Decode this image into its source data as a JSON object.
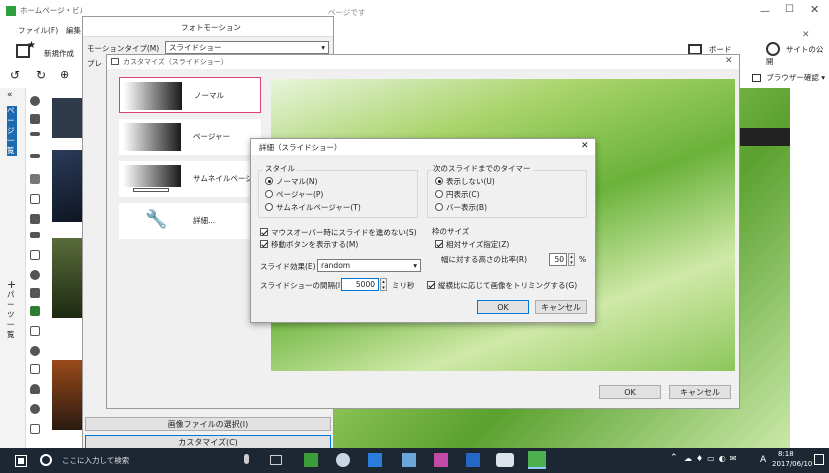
{
  "app": {
    "title": "ホームページ・ビルダー",
    "doc_title": "ページです",
    "menu_file": "ファイル(F)",
    "menu_edit": "編集",
    "new_label": "新規作成",
    "right_buttons": [
      "ボード",
      "サイトの公開"
    ],
    "browser_check": "ブラウザー確認",
    "left_vertical_labels": [
      "ページ一覧",
      "パーツ一覧"
    ]
  },
  "photo_motion": {
    "title": "フォトモーション",
    "motion_type_label": "モーションタイプ(M)",
    "motion_type_value": "スライドショー",
    "preview_label": "プレ",
    "select_image_button": "画像ファイルの選択(I)",
    "customize_button": "カスタマイズ(C)"
  },
  "customize": {
    "title": "カスタマイズ（スライドショー）",
    "items": [
      {
        "label": "ノーマル"
      },
      {
        "label": "ページャー"
      },
      {
        "label": "サムネイルページャー"
      },
      {
        "label": "詳細..."
      }
    ],
    "ok": "OK",
    "cancel": "キャンセル"
  },
  "detail": {
    "title": "詳細（スライドショー）",
    "style_group": "スタイル",
    "style_options": [
      "ノーマル(N)",
      "ページャー(P)",
      "サムネイルページャー(T)"
    ],
    "style_selected": 0,
    "timer_group": "次のスライドまでのタイマー",
    "timer_options": [
      "表示しない(U)",
      "円表示(C)",
      "バー表示(B)"
    ],
    "timer_selected": 0,
    "check_hover": "マウスオーバー時にスライドを進めない(S)",
    "check_hover_checked": true,
    "check_nav": "移動ボタンを表示する(M)",
    "check_nav_checked": true,
    "effect_label": "スライド効果(E)",
    "effect_value": "random",
    "interval_label": "スライドショーの間隔(I)",
    "interval_value": "5000",
    "interval_unit": "ミリ秒",
    "frame_group": "枠のサイズ",
    "relative_size_label": "相対サイズ指定(Z)",
    "relative_size_checked": true,
    "width_ratio_label": "幅に対する高さの比率(R)",
    "width_ratio_value": "50",
    "width_ratio_unit": "%",
    "trim_label": "縦横比に応じて画像をトリミングする(G)",
    "trim_checked": true,
    "ok": "OK",
    "cancel": "キャンセル"
  },
  "taskbar": {
    "search_placeholder": "ここに入力して検索",
    "time": "8:18",
    "date": "2017/06/10",
    "ime": "A"
  },
  "colors": {
    "accent": "#0078d7",
    "taskbar": "#1c2733",
    "pink_border": "#e0407a",
    "leaf": "#7bc043"
  }
}
